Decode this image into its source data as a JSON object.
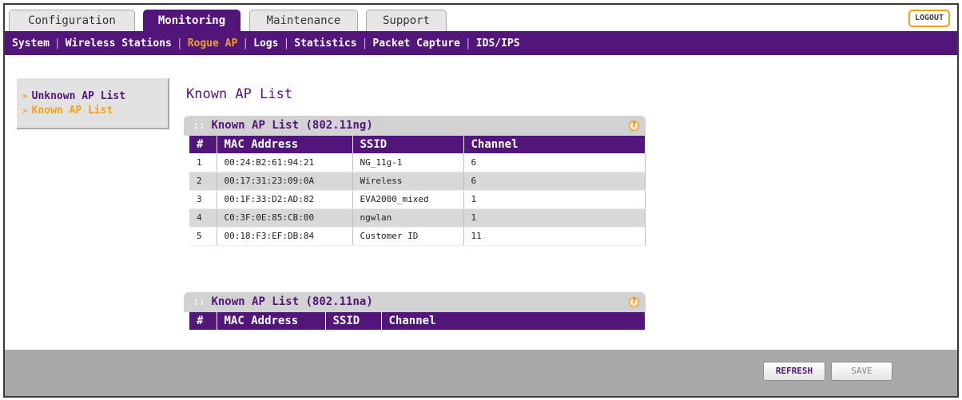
{
  "top_tabs": [
    {
      "label": "Configuration",
      "active": false
    },
    {
      "label": "Monitoring",
      "active": true
    },
    {
      "label": "Maintenance",
      "active": false
    },
    {
      "label": "Support",
      "active": false
    }
  ],
  "logout_label": "LOGOUT",
  "sub_nav": [
    {
      "label": "System",
      "active": false
    },
    {
      "label": "Wireless Stations",
      "active": false
    },
    {
      "label": "Rogue AP",
      "active": true
    },
    {
      "label": "Logs",
      "active": false
    },
    {
      "label": "Statistics",
      "active": false
    },
    {
      "label": "Packet Capture",
      "active": false
    },
    {
      "label": "IDS/IPS",
      "active": false
    }
  ],
  "left_menu": [
    {
      "label": "Unknown AP List",
      "active": false
    },
    {
      "label": "Known AP List",
      "active": true
    }
  ],
  "page_title": "Known AP List",
  "sections": {
    "ng": {
      "title": "Known AP List (802.11ng)",
      "columns": [
        "#",
        "MAC Address",
        "SSID",
        "Channel"
      ],
      "rows": [
        [
          "1",
          "00:24:B2:61:94:21",
          "NG_11g-1",
          "6"
        ],
        [
          "2",
          "00:17:31:23:09:0A",
          "Wireless",
          "6"
        ],
        [
          "3",
          "00:1F:33:D2:AD:82",
          "EVA2000_mixed",
          "1"
        ],
        [
          "4",
          "C0:3F:0E:85:CB:00",
          "ngwlan",
          "1"
        ],
        [
          "5",
          "00:18:F3:EF:DB:84",
          "Customer ID",
          "11"
        ]
      ]
    },
    "na": {
      "title": "Known AP List (802.11na)",
      "columns": [
        "#",
        "MAC Address",
        "SSID",
        "Channel"
      ],
      "rows": []
    }
  },
  "buttons": {
    "refresh": "REFRESH",
    "save": "SAVE"
  },
  "colors": {
    "brand_purple": "#52167a",
    "accent_orange": "#f0a020"
  }
}
